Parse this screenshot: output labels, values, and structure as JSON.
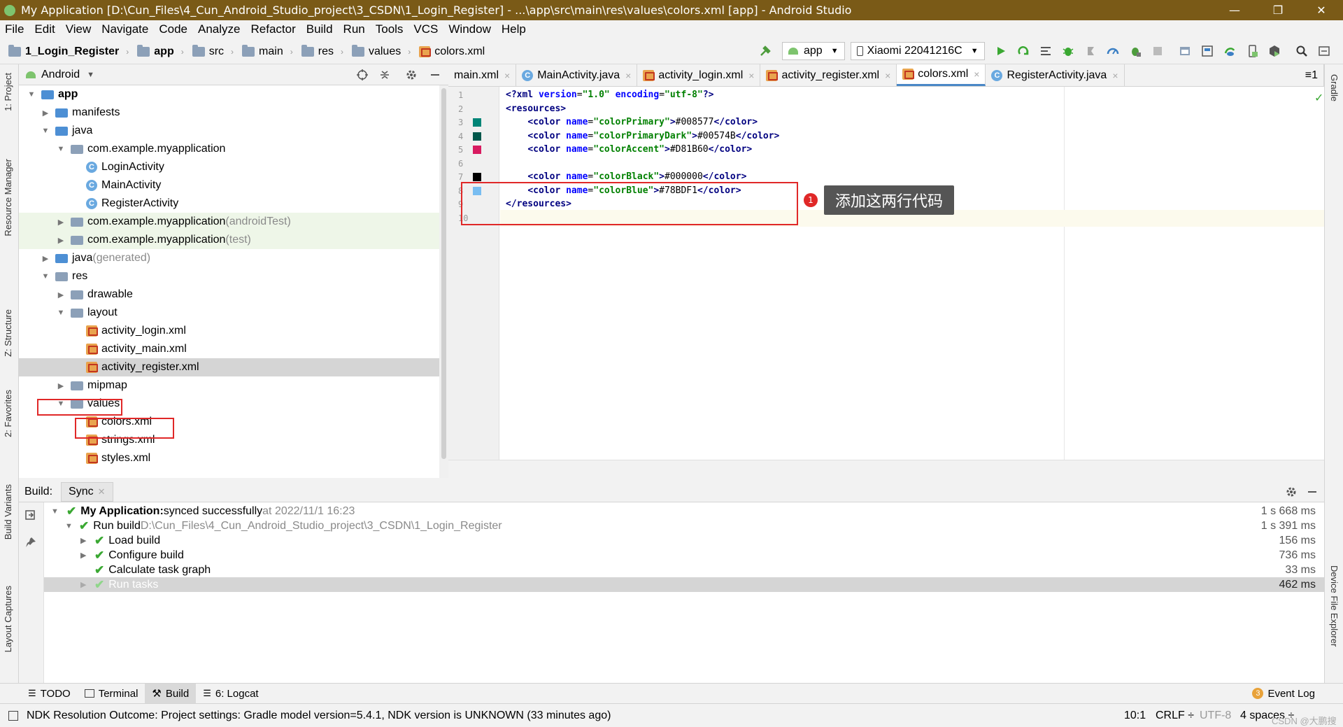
{
  "window": {
    "title": "My Application [D:\\Cun_Files\\4_Cun_Android_Studio_project\\3_CSDN\\1_Login_Register] - ...\\app\\src\\main\\res\\values\\colors.xml [app] - Android Studio",
    "min": "—",
    "max": "❐",
    "close": "✕"
  },
  "menu": [
    "File",
    "Edit",
    "View",
    "Navigate",
    "Code",
    "Analyze",
    "Refactor",
    "Build",
    "Run",
    "Tools",
    "VCS",
    "Window",
    "Help"
  ],
  "breadcrumb": [
    "1_Login_Register",
    "app",
    "src",
    "main",
    "res",
    "values",
    "colors.xml"
  ],
  "toolbar": {
    "config": "app",
    "device": "Xiaomi 22041216C"
  },
  "project": {
    "view": "Android",
    "tree": [
      {
        "label": "app",
        "suffix": "",
        "bold": true
      },
      {
        "label": "manifests",
        "suffix": ""
      },
      {
        "label": "java",
        "suffix": ""
      },
      {
        "label": "com.example.myapplication",
        "suffix": ""
      },
      {
        "label": "LoginActivity",
        "suffix": ""
      },
      {
        "label": "MainActivity",
        "suffix": ""
      },
      {
        "label": "RegisterActivity",
        "suffix": ""
      },
      {
        "label": "com.example.myapplication",
        "suffix": " (androidTest)"
      },
      {
        "label": "com.example.myapplication",
        "suffix": " (test)"
      },
      {
        "label": "java",
        "suffix": " (generated)"
      },
      {
        "label": "res",
        "suffix": ""
      },
      {
        "label": "drawable",
        "suffix": ""
      },
      {
        "label": "layout",
        "suffix": ""
      },
      {
        "label": "activity_login.xml",
        "suffix": ""
      },
      {
        "label": "activity_main.xml",
        "suffix": ""
      },
      {
        "label": "activity_register.xml",
        "suffix": ""
      },
      {
        "label": "mipmap",
        "suffix": ""
      },
      {
        "label": "values",
        "suffix": ""
      },
      {
        "label": "colors.xml",
        "suffix": ""
      },
      {
        "label": "strings.xml",
        "suffix": ""
      },
      {
        "label": "styles.xml",
        "suffix": ""
      }
    ]
  },
  "tabs": [
    "main.xml",
    "MainActivity.java",
    "activity_login.xml",
    "activity_register.xml",
    "colors.xml",
    "RegisterActivity.java"
  ],
  "tabs_more": "≡1",
  "editor": {
    "lines": [
      {
        "n": "1",
        "parts": [
          [
            "tag",
            "<?xml "
          ],
          [
            "attr",
            "version"
          ],
          [
            "txt",
            "="
          ],
          [
            "val",
            "\"1.0\""
          ],
          [
            "txt",
            " "
          ],
          [
            "attr",
            "encoding"
          ],
          [
            "txt",
            "="
          ],
          [
            "val",
            "\"utf-8\""
          ],
          [
            "tag",
            "?>"
          ]
        ]
      },
      {
        "n": "2",
        "parts": [
          [
            "tag",
            "<resources>"
          ]
        ]
      },
      {
        "n": "3",
        "parts": [
          [
            "txt",
            "    "
          ],
          [
            "tag",
            "<color "
          ],
          [
            "attr",
            "name"
          ],
          [
            "txt",
            "="
          ],
          [
            "val",
            "\"colorPrimary\""
          ],
          [
            "tag",
            ">"
          ],
          [
            "txt",
            "#008577"
          ],
          [
            "tag",
            "</color>"
          ]
        ],
        "swatch": "#008577"
      },
      {
        "n": "4",
        "parts": [
          [
            "txt",
            "    "
          ],
          [
            "tag",
            "<color "
          ],
          [
            "attr",
            "name"
          ],
          [
            "txt",
            "="
          ],
          [
            "val",
            "\"colorPrimaryDark\""
          ],
          [
            "tag",
            ">"
          ],
          [
            "txt",
            "#00574B"
          ],
          [
            "tag",
            "</color>"
          ]
        ],
        "swatch": "#00574B"
      },
      {
        "n": "5",
        "parts": [
          [
            "txt",
            "    "
          ],
          [
            "tag",
            "<color "
          ],
          [
            "attr",
            "name"
          ],
          [
            "txt",
            "="
          ],
          [
            "val",
            "\"colorAccent\""
          ],
          [
            "tag",
            ">"
          ],
          [
            "txt",
            "#D81B60"
          ],
          [
            "tag",
            "</color>"
          ]
        ],
        "swatch": "#D81B60"
      },
      {
        "n": "6",
        "parts": []
      },
      {
        "n": "7",
        "parts": [
          [
            "txt",
            "    "
          ],
          [
            "tag",
            "<color "
          ],
          [
            "attr",
            "name"
          ],
          [
            "txt",
            "="
          ],
          [
            "val",
            "\"colorBlack\""
          ],
          [
            "tag",
            ">"
          ],
          [
            "txt",
            "#000000"
          ],
          [
            "tag",
            "</color>"
          ]
        ],
        "swatch": "#000000"
      },
      {
        "n": "8",
        "parts": [
          [
            "txt",
            "    "
          ],
          [
            "tag",
            "<color "
          ],
          [
            "attr",
            "name"
          ],
          [
            "txt",
            "="
          ],
          [
            "val",
            "\"colorBlue\""
          ],
          [
            "tag",
            ">"
          ],
          [
            "txt",
            "#78BDF1"
          ],
          [
            "tag",
            "</color>"
          ]
        ],
        "swatch": "#78BDF1"
      },
      {
        "n": "9",
        "parts": [
          [
            "tag",
            "</resources>"
          ]
        ]
      },
      {
        "n": "10",
        "parts": []
      }
    ],
    "annotation": {
      "badge": "1",
      "text": "添加这两行代码"
    }
  },
  "build": {
    "title": "Build:",
    "tab": "Sync",
    "rows": [
      {
        "bold": "My Application:",
        "text": " synced successfully",
        "dim": " at 2022/11/1 16:23",
        "time": "1 s 668 ms"
      },
      {
        "bold": "",
        "text": "Run build ",
        "dim": "D:\\Cun_Files\\4_Cun_Android_Studio_project\\3_CSDN\\1_Login_Register",
        "time": "1 s 391 ms"
      },
      {
        "bold": "",
        "text": "Load build",
        "dim": "",
        "time": "156 ms"
      },
      {
        "bold": "",
        "text": "Configure build",
        "dim": "",
        "time": "736 ms"
      },
      {
        "bold": "",
        "text": "Calculate task graph",
        "dim": "",
        "time": "33 ms"
      },
      {
        "bold": "",
        "text": "Run tasks",
        "dim": "",
        "time": "462 ms"
      }
    ]
  },
  "bottom_tools": [
    "TODO",
    "Terminal",
    "Build",
    "6: Logcat"
  ],
  "event_log": {
    "count": "3",
    "label": "Event Log"
  },
  "status": {
    "message": "NDK Resolution Outcome: Project settings: Gradle model version=5.4.1, NDK version is UNKNOWN (33 minutes ago)",
    "pos": "10:1",
    "eol": "CRLF ÷",
    "enc": "UTF-8",
    "indent": "4 spaces ÷",
    "watermark": "CSDN @大鹏搜"
  },
  "side_left": [
    "1: Project",
    "Resource Manager",
    "Z: Structure",
    "2: Favorites",
    "Build Variants",
    "Layout Captures"
  ],
  "side_right": [
    "Gradle",
    "Device File Explorer"
  ]
}
